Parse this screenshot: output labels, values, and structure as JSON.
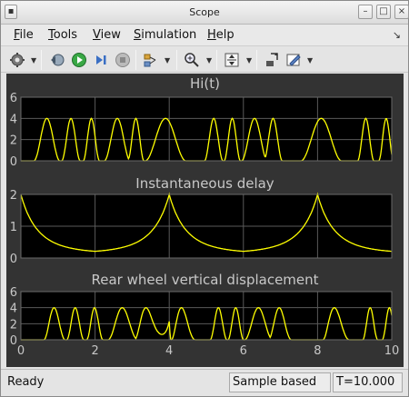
{
  "window": {
    "title": "Scope"
  },
  "menu": [
    {
      "key": "F",
      "rest": "ile"
    },
    {
      "key": "T",
      "rest": "ools"
    },
    {
      "key": "V",
      "rest": "iew"
    },
    {
      "key": "S",
      "rest": "imulation"
    },
    {
      "key": "H",
      "rest": "elp"
    }
  ],
  "toolbar": {
    "icons": [
      "settings-icon",
      "restore-icon",
      "run-icon",
      "step-forward-icon",
      "stop-icon",
      "signal-select-icon",
      "zoom-in-icon",
      "autoscale-icon",
      "highlight-block-icon",
      "edit-style-icon"
    ]
  },
  "colors": {
    "plot_bg": "#333333",
    "axes_bg": "#000000",
    "trace": "#ffff00",
    "grid": "#5a5a5a",
    "text": "#c8c8c8"
  },
  "chart_data": [
    {
      "type": "line",
      "title": "Hi(t)",
      "xlim": [
        0,
        10
      ],
      "ylim": [
        0,
        6
      ],
      "yticks": [
        0,
        2,
        4,
        6
      ],
      "xticks": [],
      "series": [
        {
          "color": "#ffff00",
          "kind": "road",
          "values_hint": "oscillates between 0 and 4"
        }
      ]
    },
    {
      "type": "line",
      "title": "Instantaneous delay",
      "xlim": [
        0,
        10
      ],
      "ylim": [
        0,
        2
      ],
      "yticks": [
        0,
        1,
        2
      ],
      "xticks": [],
      "series": [
        {
          "color": "#ffff00",
          "kind": "delay",
          "peaks_at": [
            0,
            4,
            8
          ],
          "peak_value": 2,
          "min_value": 0.15
        }
      ]
    },
    {
      "type": "line",
      "title": "Rear wheel vertical displacement",
      "xlim": [
        0,
        10
      ],
      "ylim": [
        0,
        6
      ],
      "yticks": [
        0,
        2,
        4,
        6
      ],
      "xticks": [
        0,
        2,
        4,
        6,
        8,
        10
      ],
      "series": [
        {
          "color": "#ffff00",
          "kind": "rear",
          "delay_start": 0.6
        }
      ]
    }
  ],
  "status": {
    "ready": "Ready",
    "mode": "Sample based",
    "time": "T=10.000"
  }
}
